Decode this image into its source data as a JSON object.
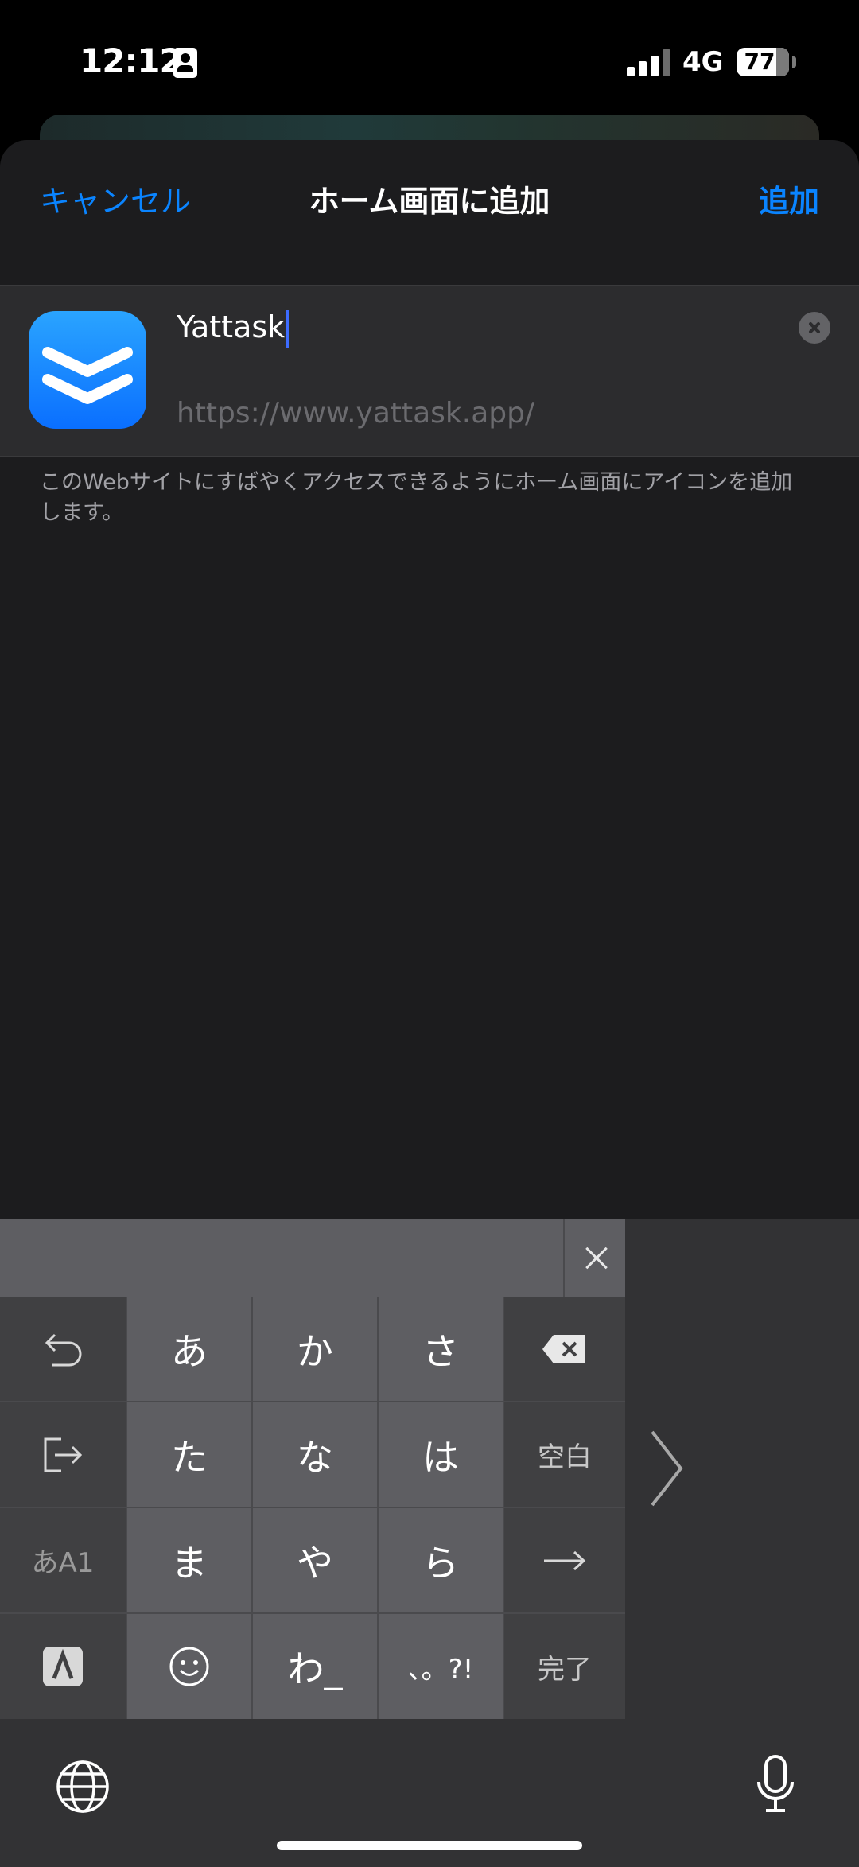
{
  "status_bar": {
    "time": "12:12",
    "network": "4G",
    "battery": "77"
  },
  "nav": {
    "cancel_label": "キャンセル",
    "title": "ホーム画面に追加",
    "add_label": "追加"
  },
  "form": {
    "name_value": "Yattask",
    "url_value": "https://www.yattask.app/",
    "app_icon": "yattask-double-chevron-icon"
  },
  "description": "このWebサイトにすばやくアクセスできるようにホーム画面にアイコンを追加します。",
  "keyboard": {
    "row1": [
      "あ",
      "か",
      "さ"
    ],
    "row2": [
      "た",
      "な",
      "は"
    ],
    "row3": [
      "ま",
      "や",
      "ら"
    ],
    "row4": [
      "わ_",
      "、。?!"
    ],
    "space_label": "空白",
    "done_label": "完了",
    "mode_label": "あA1"
  },
  "colors": {
    "accent": "#0a84ff",
    "sheet_bg": "#1c1c1e",
    "field_bg": "#2c2c2e",
    "key_bg": "#5e5e62",
    "func_key_bg": "#404042"
  }
}
